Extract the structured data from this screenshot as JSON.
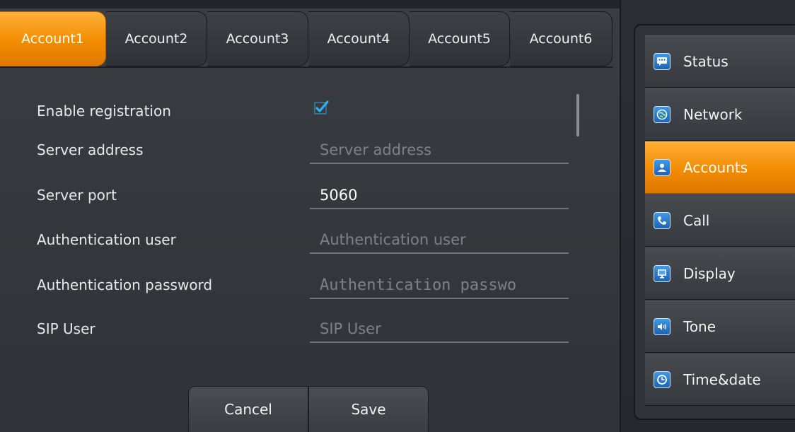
{
  "tabs": [
    {
      "label": "Account1",
      "active": true
    },
    {
      "label": "Account2",
      "active": false
    },
    {
      "label": "Account3",
      "active": false
    },
    {
      "label": "Account4",
      "active": false
    },
    {
      "label": "Account5",
      "active": false
    },
    {
      "label": "Account6",
      "active": false
    }
  ],
  "form": {
    "enable_registration": {
      "label": "Enable registration",
      "checked": true
    },
    "server_address": {
      "label": "Server address",
      "placeholder": "Server address",
      "value": ""
    },
    "server_port": {
      "label": "Server port",
      "value": "5060"
    },
    "auth_user": {
      "label": "Authentication user",
      "placeholder": "Authentication user",
      "value": ""
    },
    "auth_password": {
      "label": "Authentication password",
      "placeholder": "Authentication passwo",
      "value": ""
    },
    "sip_user": {
      "label": "SIP User",
      "placeholder": "SIP User",
      "value": ""
    }
  },
  "buttons": {
    "cancel": "Cancel",
    "save": "Save"
  },
  "nav": [
    {
      "label": "Status",
      "icon": "status-icon",
      "active": false
    },
    {
      "label": "Network",
      "icon": "network-icon",
      "active": false
    },
    {
      "label": "Accounts",
      "icon": "accounts-icon",
      "active": true
    },
    {
      "label": "Call",
      "icon": "call-icon",
      "active": false
    },
    {
      "label": "Display",
      "icon": "display-icon",
      "active": false
    },
    {
      "label": "Tone",
      "icon": "tone-icon",
      "active": false
    },
    {
      "label": "Time&date",
      "icon": "time-date-icon",
      "active": false
    }
  ],
  "colors": {
    "accent": "#f28c00",
    "checkbox": "#2fb2f0",
    "background": "#34373b"
  }
}
